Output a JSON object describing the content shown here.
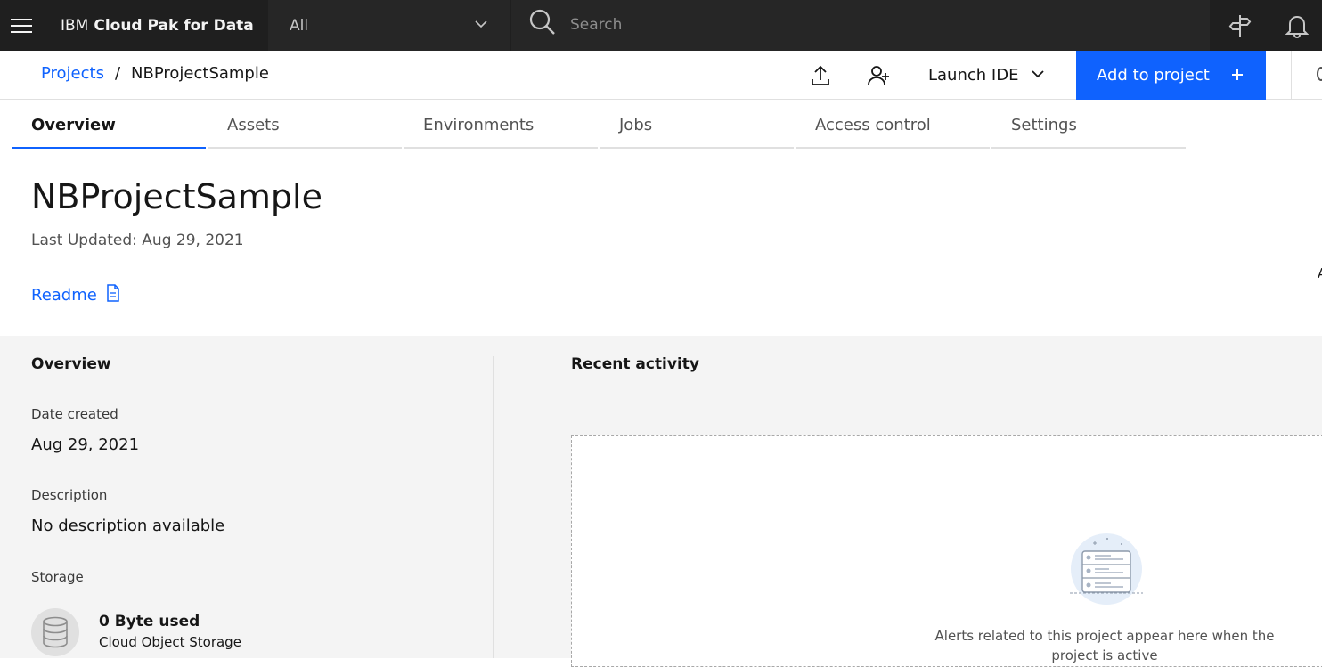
{
  "header": {
    "brand_prefix": "IBM",
    "brand_name": "Cloud Pak for Data",
    "scope_value": "All",
    "search_placeholder": "Search"
  },
  "breadcrumb": {
    "parent": "Projects",
    "separator": "/",
    "current": "NBProjectSample"
  },
  "actions": {
    "launch_ide": "Launch IDE",
    "add_to_project": "Add to project"
  },
  "tabs": [
    {
      "label": "Overview",
      "active": true
    },
    {
      "label": "Assets",
      "active": false
    },
    {
      "label": "Environments",
      "active": false
    },
    {
      "label": "Jobs",
      "active": false
    },
    {
      "label": "Access control",
      "active": false
    },
    {
      "label": "Settings",
      "active": false
    }
  ],
  "project": {
    "title": "NBProjectSample",
    "last_updated": "Last Updated: Aug 29, 2021",
    "readme_label": "Readme",
    "edge_letter": "A"
  },
  "overview": {
    "heading": "Overview",
    "date_created_label": "Date created",
    "date_created_value": "Aug 29, 2021",
    "description_label": "Description",
    "description_value": "No description available",
    "storage_label": "Storage",
    "storage_used": "0 Byte used",
    "storage_type": "Cloud Object Storage"
  },
  "activity": {
    "heading": "Recent activity",
    "empty_message": "Alerts related to this project appear here when the project is active"
  },
  "colors": {
    "shell_bg": "#1f1f1f",
    "primary": "#0f62fe",
    "panel_bg": "#f4f4f4"
  },
  "icons": [
    "menu-icon",
    "chevron-down-icon",
    "search-icon",
    "signpost-icon",
    "notification-icon",
    "upload-icon",
    "add-user-icon",
    "plus-icon",
    "document-icon",
    "database-icon"
  ]
}
